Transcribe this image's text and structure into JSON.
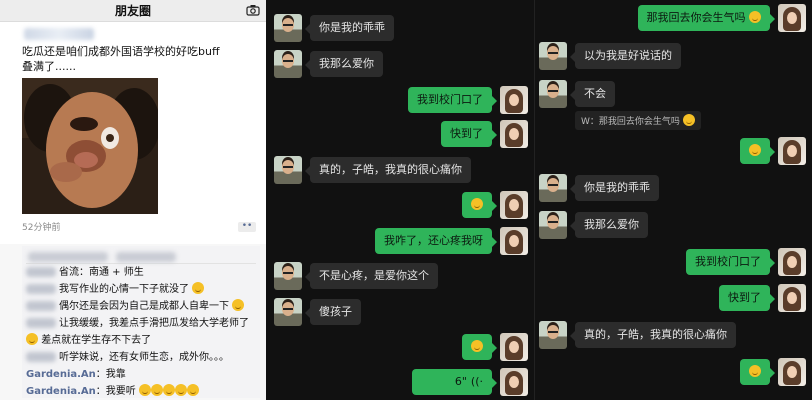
{
  "moments": {
    "title": "朋友圈",
    "post_text": "吃瓜还是咱们成都外国语学校的好吃buff叠满了......",
    "time": "52分钟前",
    "more": "••",
    "comments": [
      {
        "name": "",
        "text": "省流：南通 + 师生"
      },
      {
        "name": "",
        "text": "我写作业的心情一下子就没了"
      },
      {
        "name": "",
        "text": "偶尔还是会因为自己是成都人自卑一下"
      },
      {
        "name": "",
        "text": "让我缓缓，我差点手滑把瓜发给大学老师了"
      },
      {
        "name": "",
        "text": "差点就在学生存不下去了"
      },
      {
        "name": "",
        "text": "听学妹说，还有女师生恋，成外你。。。"
      },
      {
        "name": "Gardenia.An",
        "text": "：我靠"
      },
      {
        "name": "Gardenia.An",
        "text": "：我要听"
      }
    ]
  },
  "chat1": {
    "messages": [
      {
        "side": "in",
        "text": "你是我的乖乖"
      },
      {
        "side": "in",
        "text": "我那么爱你"
      },
      {
        "side": "out",
        "text": "我到校门口了"
      },
      {
        "side": "out",
        "text": "快到了"
      },
      {
        "side": "in",
        "text": "真的，子皓，我真的很心痛你"
      },
      {
        "side": "out",
        "text": ""
      },
      {
        "side": "out",
        "text": "我咋了，还心疼我呀"
      },
      {
        "side": "in",
        "text": "不是心疼，是爱你这个"
      },
      {
        "side": "in",
        "text": "傻孩子"
      },
      {
        "side": "out",
        "text": ""
      },
      {
        "side": "out",
        "text": "6\""
      }
    ]
  },
  "chat2": {
    "messages": [
      {
        "side": "out",
        "text": "那我回去你会生气吗"
      },
      {
        "side": "in",
        "text": "以为我是好说话的"
      },
      {
        "side": "in",
        "text": "不会"
      },
      {
        "side": "quote",
        "text": "W：那我回去你会生气吗"
      },
      {
        "side": "out",
        "text": ""
      },
      {
        "side": "in",
        "text": "你是我的乖乖"
      },
      {
        "side": "in",
        "text": "我那么爱你"
      },
      {
        "side": "out",
        "text": "我到校门口了"
      },
      {
        "side": "out",
        "text": "快到了"
      },
      {
        "side": "in",
        "text": "真的，子皓，我真的很心痛你"
      },
      {
        "side": "out",
        "text": ""
      }
    ]
  }
}
